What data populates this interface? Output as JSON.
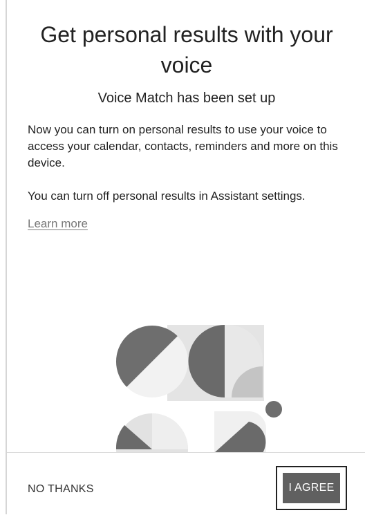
{
  "dialog": {
    "title": "Get personal results with your voice",
    "subtitle": "Voice Match has been set up",
    "paragraph_1": "Now you can turn on personal results to use your voice to access your calendar, contacts, reminders and more on this device.",
    "paragraph_2": "You can turn off personal results in Assistant settings.",
    "learn_more": "Learn more"
  },
  "illustration": {
    "icon": "voice-match-illustration"
  },
  "footer": {
    "decline_label": "NO THANKS",
    "agree_label": "I AGREE"
  },
  "colors": {
    "primary_button": "#606060",
    "link": "#777777",
    "divider": "#d9d9d9"
  }
}
